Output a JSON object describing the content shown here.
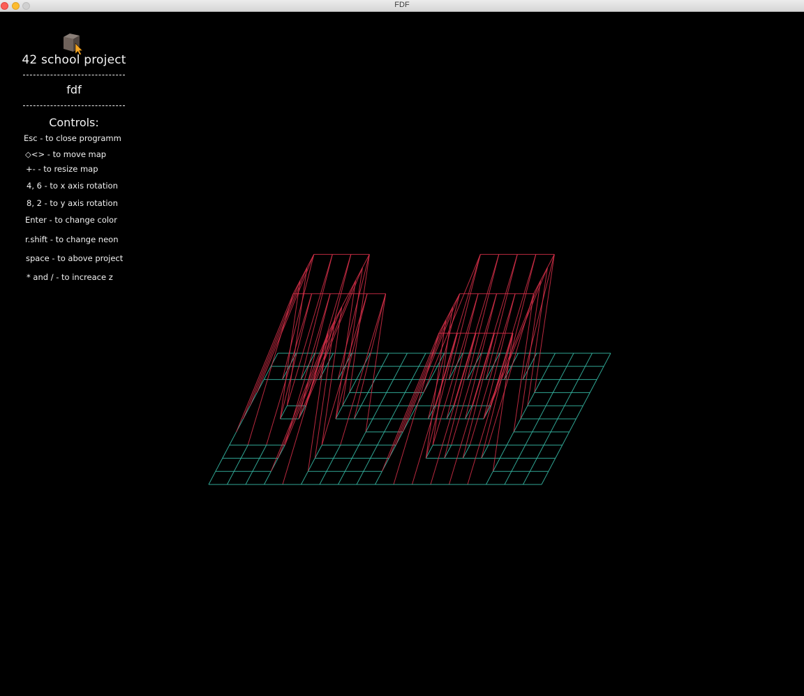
{
  "window": {
    "title": "FDF"
  },
  "panel": {
    "project_title": "42 school project",
    "divider_1": "--------------------",
    "program_name": "fdf",
    "divider_2": "--------------------",
    "controls_title": "Controls:",
    "controls": [
      "Esc - to close programm",
      "◇<> - to move map",
      "+- - to resize map",
      "4, 6 - to x axis rotation",
      "8, 2 - to y axis rotation",
      "Enter - to change color",
      "r.shift - to change neon",
      "space - to above project",
      "* and / - to increace z"
    ]
  },
  "icons": {
    "logo": "cube-logo-icon",
    "cursor": "mouse-pointer-icon"
  },
  "colors": {
    "background": "#000000",
    "grid_low": "#35b8a4",
    "grid_high": "#d9304a",
    "text": "#f4f4f4"
  }
}
